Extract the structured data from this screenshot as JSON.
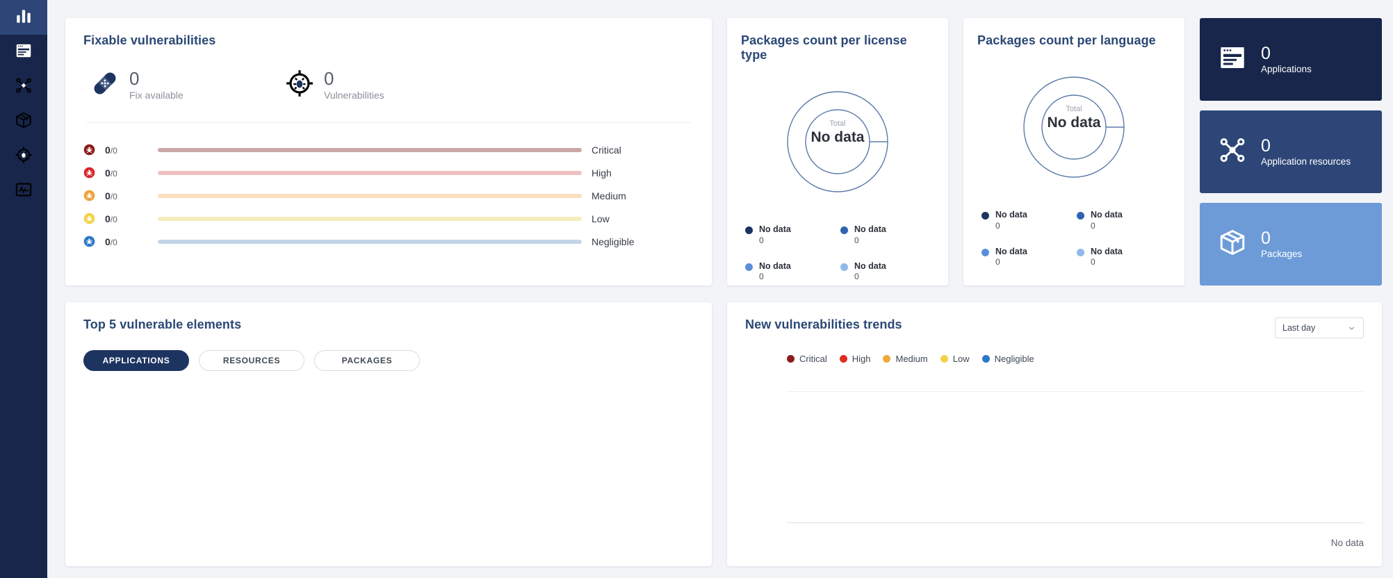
{
  "sidebar": {
    "items": [
      {
        "name": "dashboard",
        "icon": "bar-chart-icon",
        "active": true
      },
      {
        "name": "applications",
        "icon": "window-list-icon",
        "active": false
      },
      {
        "name": "application-resources",
        "icon": "network-nodes-icon",
        "active": false
      },
      {
        "name": "packages",
        "icon": "package-box-icon",
        "active": false
      },
      {
        "name": "vulnerabilities",
        "icon": "bug-target-icon",
        "active": false
      },
      {
        "name": "trends",
        "icon": "activity-monitor-icon",
        "active": false
      }
    ]
  },
  "fixable": {
    "title": "Fixable vulnerabilities",
    "metrics": [
      {
        "icon": "bandage-icon",
        "value": "0",
        "label": "Fix available"
      },
      {
        "icon": "bug-target-icon",
        "value": "0",
        "label": "Vulnerabilities"
      }
    ],
    "severities": [
      {
        "label": "Critical",
        "count": "0",
        "denominator": "/0",
        "icon_color": "#8c1b1b",
        "bar_color": "#c9a7a7"
      },
      {
        "label": "High",
        "count": "0",
        "denominator": "/0",
        "icon_color": "#d8232a",
        "bar_color": "#eec1c1"
      },
      {
        "label": "Medium",
        "count": "0",
        "denominator": "/0",
        "icon_color": "#eda13a",
        "bar_color": "#fbdfbe"
      },
      {
        "label": "Low",
        "count": "0",
        "denominator": "/0",
        "icon_color": "#f2d147",
        "bar_color": "#f7ecbb"
      },
      {
        "label": "Negligible",
        "count": "0",
        "denominator": "/0",
        "icon_color": "#2b78c4",
        "bar_color": "#c3d6e8"
      }
    ]
  },
  "license_chart": {
    "title": "Packages count per license type",
    "center_label": "Total",
    "center_value": "No data",
    "legend": [
      {
        "label": "No data",
        "value": "0",
        "color": "#1d3461"
      },
      {
        "label": "No data",
        "value": "0",
        "color": "#2f63b0"
      },
      {
        "label": "No data",
        "value": "0",
        "color": "#5a8fd8"
      },
      {
        "label": "No data",
        "value": "0",
        "color": "#8fb9ea"
      }
    ]
  },
  "language_chart": {
    "title": "Packages count per language",
    "center_label": "Total",
    "center_value": "No data",
    "legend": [
      {
        "label": "No data",
        "value": "0",
        "color": "#1d3461"
      },
      {
        "label": "No data",
        "value": "0",
        "color": "#2f63b0"
      },
      {
        "label": "No data",
        "value": "0",
        "color": "#5a8fd8"
      },
      {
        "label": "No data",
        "value": "0",
        "color": "#8fb9ea"
      }
    ]
  },
  "kpis": [
    {
      "value": "0",
      "label": "Applications",
      "icon": "window-list-icon",
      "bg": "#17264a"
    },
    {
      "value": "0",
      "label": "Application resources",
      "icon": "network-nodes-icon",
      "bg": "#2d4677"
    },
    {
      "value": "0",
      "label": "Packages",
      "icon": "package-box-icon",
      "bg": "#6d9bd8"
    }
  ],
  "top5": {
    "title": "Top 5 vulnerable elements",
    "tabs": [
      {
        "label": "APPLICATIONS",
        "active": true
      },
      {
        "label": "RESOURCES",
        "active": false
      },
      {
        "label": "PACKAGES",
        "active": false
      }
    ]
  },
  "trends": {
    "title": "New vulnerabilities trends",
    "range_value": "Last day",
    "empty_text": "No data",
    "legend": [
      {
        "label": "Critical",
        "color": "#8c1b1b"
      },
      {
        "label": "High",
        "color": "#e02b20"
      },
      {
        "label": "Medium",
        "color": "#f0a83c"
      },
      {
        "label": "Low",
        "color": "#f2d147"
      },
      {
        "label": "Negligible",
        "color": "#2b78c4"
      }
    ]
  },
  "chart_data": [
    {
      "type": "bar",
      "title": "Fixable vulnerabilities",
      "categories": [
        "Critical",
        "High",
        "Medium",
        "Low",
        "Negligible"
      ],
      "values": [
        0,
        0,
        0,
        0,
        0
      ],
      "totals": [
        0,
        0,
        0,
        0,
        0
      ],
      "xlabel": "",
      "ylabel": "",
      "grid": false,
      "legend_position": "right"
    },
    {
      "type": "pie",
      "title": "Packages count per license type",
      "categories": [
        "No data",
        "No data",
        "No data",
        "No data"
      ],
      "values": [
        0,
        0,
        0,
        0
      ],
      "total": 0,
      "legend_position": "bottom"
    },
    {
      "type": "pie",
      "title": "Packages count per language",
      "categories": [
        "No data",
        "No data",
        "No data",
        "No data"
      ],
      "values": [
        0,
        0,
        0,
        0
      ],
      "total": 0,
      "legend_position": "bottom"
    },
    {
      "type": "line",
      "title": "New vulnerabilities trends",
      "x": [],
      "series": [
        {
          "name": "Critical",
          "values": []
        },
        {
          "name": "High",
          "values": []
        },
        {
          "name": "Medium",
          "values": []
        },
        {
          "name": "Low",
          "values": []
        },
        {
          "name": "Negligible",
          "values": []
        }
      ],
      "xlabel": "",
      "ylabel": "",
      "grid": false,
      "legend_position": "top"
    }
  ]
}
